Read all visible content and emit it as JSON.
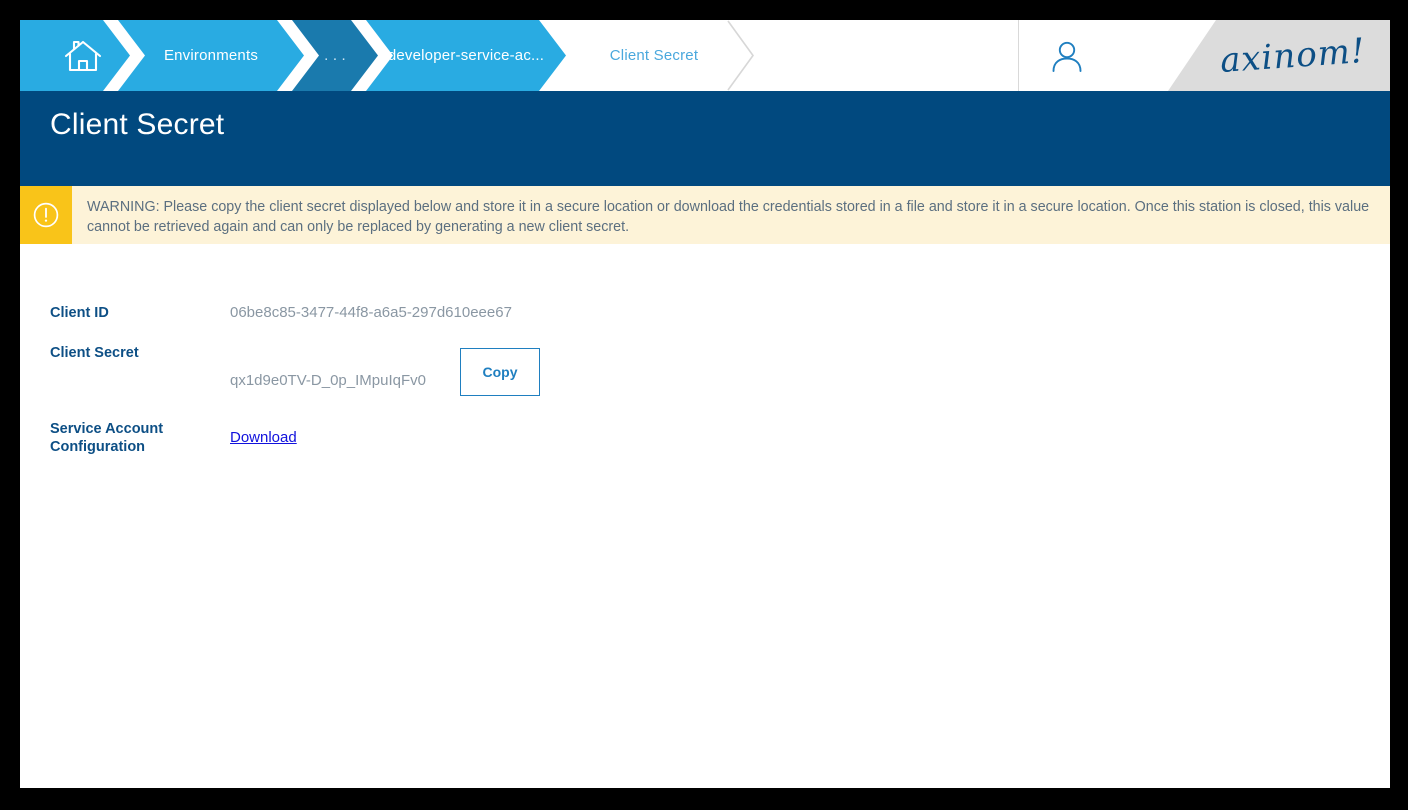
{
  "header": {
    "breadcrumb": {
      "home_icon": "home-icon",
      "items": [
        {
          "label": "Environments",
          "state": "inactive"
        },
        {
          "label": ". . .",
          "state": "overflow"
        },
        {
          "label": "developer-service-ac...",
          "state": "inactive"
        },
        {
          "label": "Client Secret",
          "state": "active"
        }
      ]
    },
    "user_icon": "user-account-icon",
    "logo": "axinom!"
  },
  "page": {
    "title": "Client Secret"
  },
  "warning": {
    "icon": "alert-circle-icon",
    "text": "WARNING: Please copy the client secret displayed below and store it in a secure location or download the credentials stored in a file and store it in a secure location. Once this station is closed, this value cannot be retrieved again and can only be replaced by generating a new client secret."
  },
  "form": {
    "client_id": {
      "label": "Client ID",
      "value": "06be8c85-3477-44f8-a6a5-297d610eee67"
    },
    "client_secret": {
      "label": "Client Secret",
      "value": "qx1d9e0TV-D_0p_IMpuIqFv0",
      "copy_label": "Copy"
    },
    "service_account_configuration": {
      "label": "Service Account Configuration",
      "download_label": "Download"
    }
  },
  "colors": {
    "breadcrumb_blue": "#29abe2",
    "breadcrumb_dark_blue": "#1a7aad",
    "title_bar_blue": "#01497f",
    "warning_yellow": "#f9c419",
    "warning_background": "#fdf3d8",
    "link_blue": "#1111dd",
    "button_blue": "#1f7fc0",
    "logo_background": "#dcdcdc"
  }
}
